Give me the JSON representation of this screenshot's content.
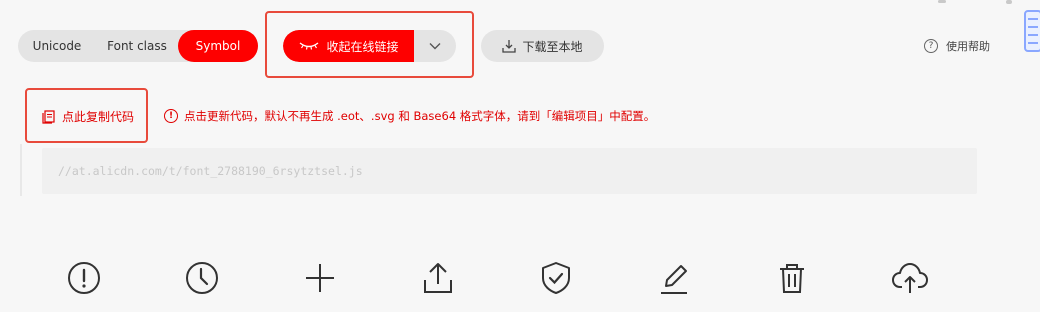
{
  "tabs": [
    {
      "label": "Unicode",
      "active": false
    },
    {
      "label": "Font class",
      "active": false
    },
    {
      "label": "Symbol",
      "active": true
    }
  ],
  "toolbar": {
    "collapse_link_label": "收起在线链接",
    "download_label": "下载至本地",
    "help_label": "使用帮助",
    "help_icon_text": "?"
  },
  "code": {
    "copy_label": "点此复制代码",
    "notice_icon_text": "!",
    "notice": "点击更新代码，默认不再生成 .eot、.svg 和 Base64 格式字体，请到「编辑项目」中配置。",
    "url": "//at.alicdn.com/t/font_2788190_6rsytztsel.js"
  },
  "actions": [
    {
      "icon": "info-icon"
    },
    {
      "icon": "clock-icon"
    },
    {
      "icon": "plus-icon"
    },
    {
      "icon": "upload-icon"
    },
    {
      "icon": "shield-check-icon"
    },
    {
      "icon": "edit-icon"
    },
    {
      "icon": "trash-icon"
    },
    {
      "icon": "cloud-upload-icon"
    }
  ],
  "colors": {
    "accent": "#fe0000",
    "highlight": "#e84a3b",
    "notice": "#e00000"
  }
}
